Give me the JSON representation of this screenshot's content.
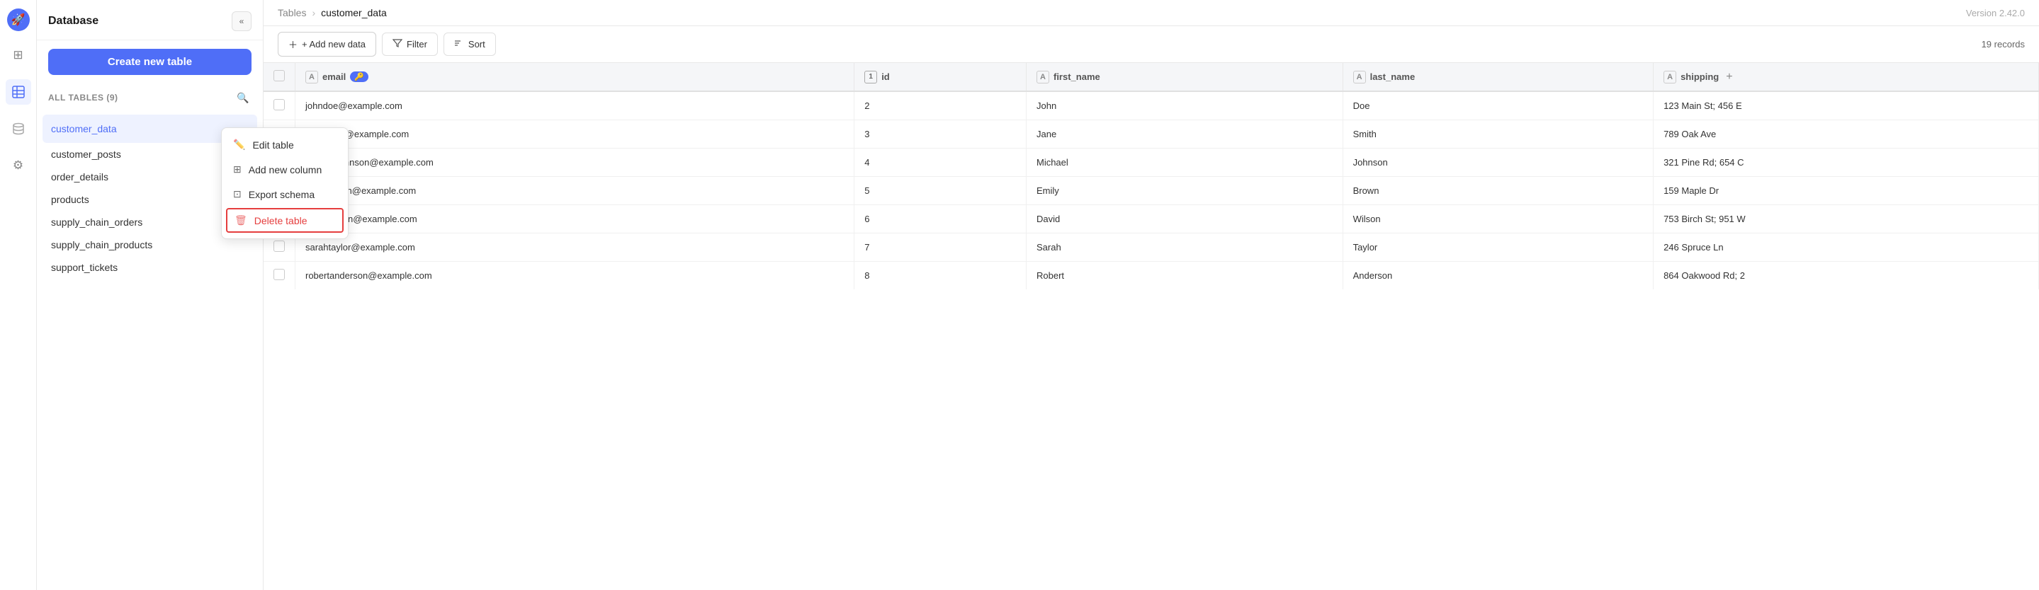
{
  "app": {
    "title": "Database",
    "version": "Version 2.42.0"
  },
  "sidebar": {
    "collapse_label": "«",
    "create_table_label": "Create new table",
    "tables_section_label": "ALL TABLES (9)",
    "tables": [
      {
        "name": "customer_data",
        "active": true
      },
      {
        "name": "customer_posts",
        "active": false
      },
      {
        "name": "order_details",
        "active": false
      },
      {
        "name": "products",
        "active": false
      },
      {
        "name": "supply_chain_orders",
        "active": false
      },
      {
        "name": "supply_chain_products",
        "active": false
      },
      {
        "name": "support_tickets",
        "active": false
      }
    ]
  },
  "context_menu": {
    "items": [
      {
        "id": "edit",
        "label": "Edit table",
        "icon": "✏️"
      },
      {
        "id": "add_col",
        "label": "Add new column",
        "icon": "⊞"
      },
      {
        "id": "export",
        "label": "Export schema",
        "icon": "⊡"
      },
      {
        "id": "delete",
        "label": "Delete table",
        "icon": "🗑",
        "danger": true
      }
    ]
  },
  "breadcrumb": {
    "parent": "Tables",
    "current": "customer_data"
  },
  "toolbar": {
    "add_label": "+ Add new data",
    "filter_label": "Filter",
    "sort_label": "Sort",
    "records_label": "19 records"
  },
  "table": {
    "columns": [
      {
        "id": "checkbox",
        "label": "",
        "type": "check"
      },
      {
        "id": "email",
        "label": "email",
        "type": "text",
        "has_key": true
      },
      {
        "id": "id",
        "label": "id",
        "type": "num"
      },
      {
        "id": "first_name",
        "label": "first_name",
        "type": "text"
      },
      {
        "id": "last_name",
        "label": "last_name",
        "type": "text"
      },
      {
        "id": "shipping",
        "label": "shipping",
        "type": "text"
      }
    ],
    "rows": [
      {
        "checkbox": "",
        "email": "johndoe@example.com",
        "id": "2",
        "first_name": "John",
        "last_name": "Doe",
        "shipping": "123 Main St; 456 E"
      },
      {
        "checkbox": "",
        "email": "janesmith@example.com",
        "id": "3",
        "first_name": "Jane",
        "last_name": "Smith",
        "shipping": "789 Oak Ave"
      },
      {
        "checkbox": "",
        "email": "michaeljohnson@example.com",
        "id": "4",
        "first_name": "Michael",
        "last_name": "Johnson",
        "shipping": "321 Pine Rd; 654 C"
      },
      {
        "checkbox": "",
        "email": "emilybrown@example.com",
        "id": "5",
        "first_name": "Emily",
        "last_name": "Brown",
        "shipping": "159 Maple Dr"
      },
      {
        "checkbox": "",
        "email": "davidwilson@example.com",
        "id": "6",
        "first_name": "David",
        "last_name": "Wilson",
        "shipping": "753 Birch St; 951 W"
      },
      {
        "checkbox": "",
        "email": "sarahtaylor@example.com",
        "id": "7",
        "first_name": "Sarah",
        "last_name": "Taylor",
        "shipping": "246 Spruce Ln"
      },
      {
        "checkbox": "",
        "email": "robertanderson@example.com",
        "id": "8",
        "first_name": "Robert",
        "last_name": "Anderson",
        "shipping": "864 Oakwood Rd; 2"
      }
    ]
  },
  "icons": {
    "app": "🚀",
    "grid": "⊞",
    "table": "☰",
    "database": "🗄",
    "settings": "⚙",
    "search": "🔍",
    "filter": "⚗",
    "sort": "≡",
    "edit": "✏",
    "column": "⊞",
    "export": "↗",
    "delete": "🗑"
  }
}
